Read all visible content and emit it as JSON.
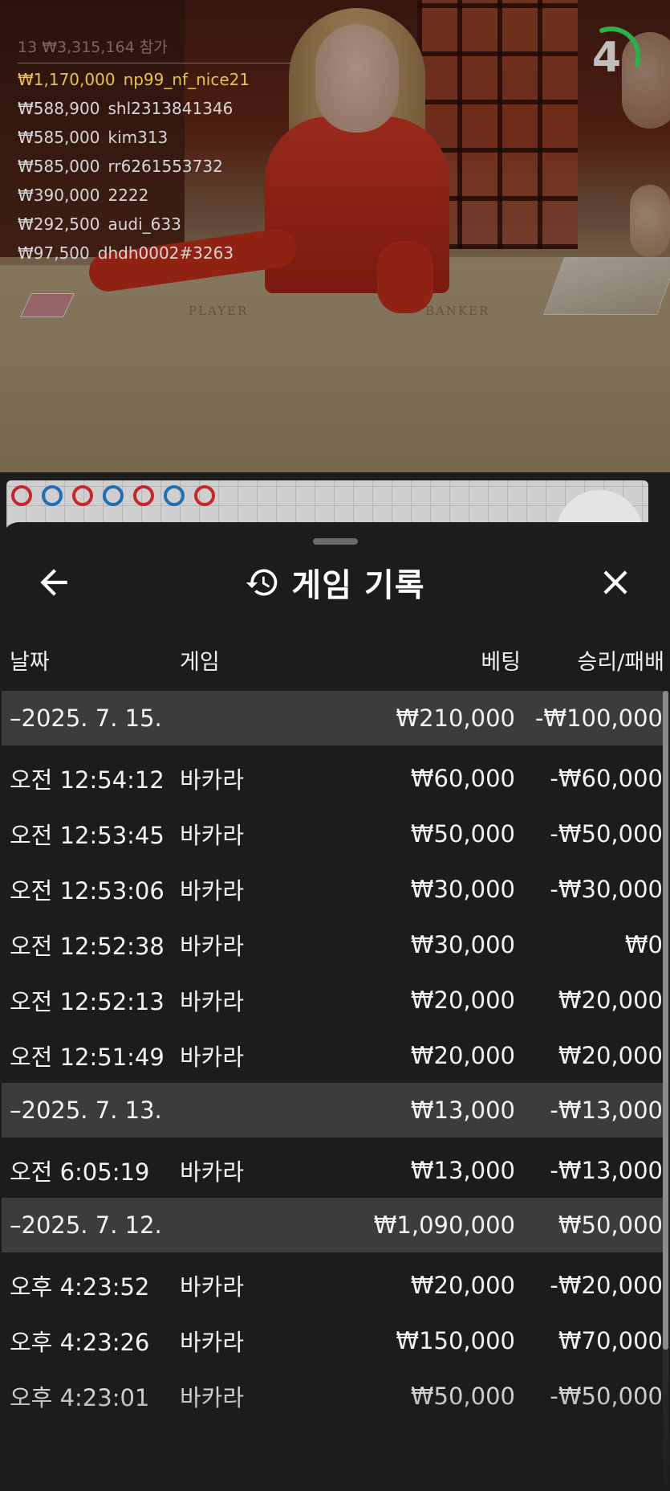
{
  "video": {
    "table_labels": [
      "PLAYER",
      "BANKER"
    ],
    "countdown": "4"
  },
  "winners": {
    "total_line": "13 ₩3,315,164 참가",
    "rows": [
      {
        "amount": "₩1,170,000",
        "user": "np99_nf_nice21",
        "highlight": true
      },
      {
        "amount": "₩588,900",
        "user": "shl2313841346",
        "highlight": false
      },
      {
        "amount": "₩585,000",
        "user": "kim313",
        "highlight": false
      },
      {
        "amount": "₩585,000",
        "user": "rr6261553732",
        "highlight": false
      },
      {
        "amount": "₩390,000",
        "user": "2222",
        "highlight": false
      },
      {
        "amount": "₩292,500",
        "user": "audi_633",
        "highlight": false
      },
      {
        "amount": "₩97,500",
        "user": "dhdh0002#3263",
        "highlight": false
      }
    ]
  },
  "scoreboard": {
    "beads": [
      "red",
      "blue",
      "red",
      "blue",
      "red",
      "blue",
      "red"
    ]
  },
  "sheet": {
    "title": "게임 기록",
    "icons": {
      "back": "arrow-left-icon",
      "title": "history-icon",
      "close": "close-icon"
    },
    "columns": {
      "date": "날짜",
      "game": "게임",
      "bet": "베팅",
      "result": "승리/패배"
    },
    "groups": [
      {
        "date": "–2025. 7. 15.",
        "bet_total": "₩210,000",
        "result_total": "-₩100,000",
        "rows": [
          {
            "time": "오전 12:54:12",
            "game": "바카라",
            "bet": "₩60,000",
            "result": "-₩60,000"
          },
          {
            "time": "오전 12:53:45",
            "game": "바카라",
            "bet": "₩50,000",
            "result": "-₩50,000"
          },
          {
            "time": "오전 12:53:06",
            "game": "바카라",
            "bet": "₩30,000",
            "result": "-₩30,000"
          },
          {
            "time": "오전 12:52:38",
            "game": "바카라",
            "bet": "₩30,000",
            "result": "₩0"
          },
          {
            "time": "오전 12:52:13",
            "game": "바카라",
            "bet": "₩20,000",
            "result": "₩20,000"
          },
          {
            "time": "오전 12:51:49",
            "game": "바카라",
            "bet": "₩20,000",
            "result": "₩20,000"
          }
        ]
      },
      {
        "date": "–2025. 7. 13.",
        "bet_total": "₩13,000",
        "result_total": "-₩13,000",
        "rows": [
          {
            "time": "오전 6:05:19",
            "game": "바카라",
            "bet": "₩13,000",
            "result": "-₩13,000"
          }
        ]
      },
      {
        "date": "–2025. 7. 12.",
        "bet_total": "₩1,090,000",
        "result_total": "₩50,000",
        "rows": [
          {
            "time": "오후 4:23:52",
            "game": "바카라",
            "bet": "₩20,000",
            "result": "-₩20,000"
          },
          {
            "time": "오후 4:23:26",
            "game": "바카라",
            "bet": "₩150,000",
            "result": "₩70,000"
          },
          {
            "time": "오후 4:23:01",
            "game": "바카라",
            "bet": "₩50,000",
            "result": "-₩50,000"
          }
        ]
      }
    ]
  }
}
